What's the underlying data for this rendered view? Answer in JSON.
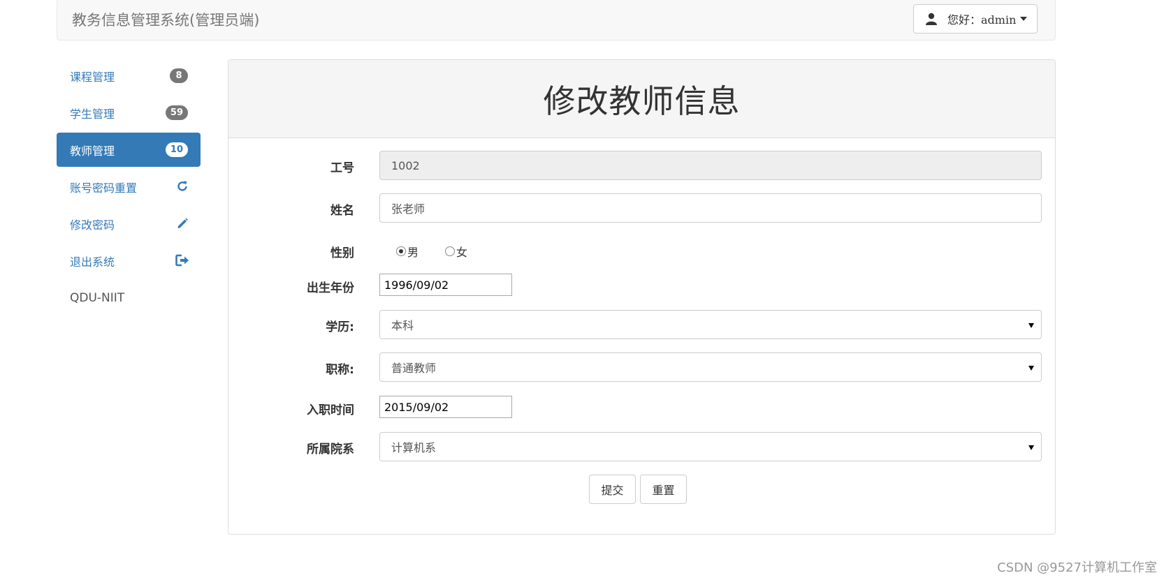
{
  "navbar": {
    "brand": "教务信息管理系统(管理员端)",
    "user_menu_label": "您好：admin",
    "user_icon": "user-icon"
  },
  "sidebar": {
    "items": [
      {
        "label": "课程管理",
        "badge": "8",
        "active": false
      },
      {
        "label": "学生管理",
        "badge": "59",
        "active": false
      },
      {
        "label": "教师管理",
        "badge": "10",
        "active": true
      },
      {
        "label": "账号密码重置",
        "icon": "refresh-icon"
      },
      {
        "label": "修改密码",
        "icon": "pencil-icon"
      },
      {
        "label": "退出系统",
        "icon": "logout-icon"
      }
    ],
    "footer": "QDU-NIIT"
  },
  "panel": {
    "title": "修改教师信息"
  },
  "form": {
    "id_label": "工号",
    "id_value": "1002",
    "name_label": "姓名",
    "name_value": "张老师",
    "gender_label": "性别",
    "gender_options": [
      "男",
      "女"
    ],
    "gender_selected": "男",
    "birth_label": "出生年份",
    "birth_value": "1996/09/02",
    "education_label": "学历:",
    "education_value": "本科",
    "title_label": "职称:",
    "title_value": "普通教师",
    "hire_label": "入职时间",
    "hire_value": "2015/09/02",
    "dept_label": "所属院系",
    "dept_value": "计算机系",
    "submit_label": "提交",
    "reset_label": "重置"
  },
  "watermark": "CSDN @9527计算机工作室",
  "colors": {
    "primary": "#337ab7",
    "badge": "#777777",
    "panel_heading": "#f5f5f5",
    "navbar_bg": "#f8f8f8"
  }
}
